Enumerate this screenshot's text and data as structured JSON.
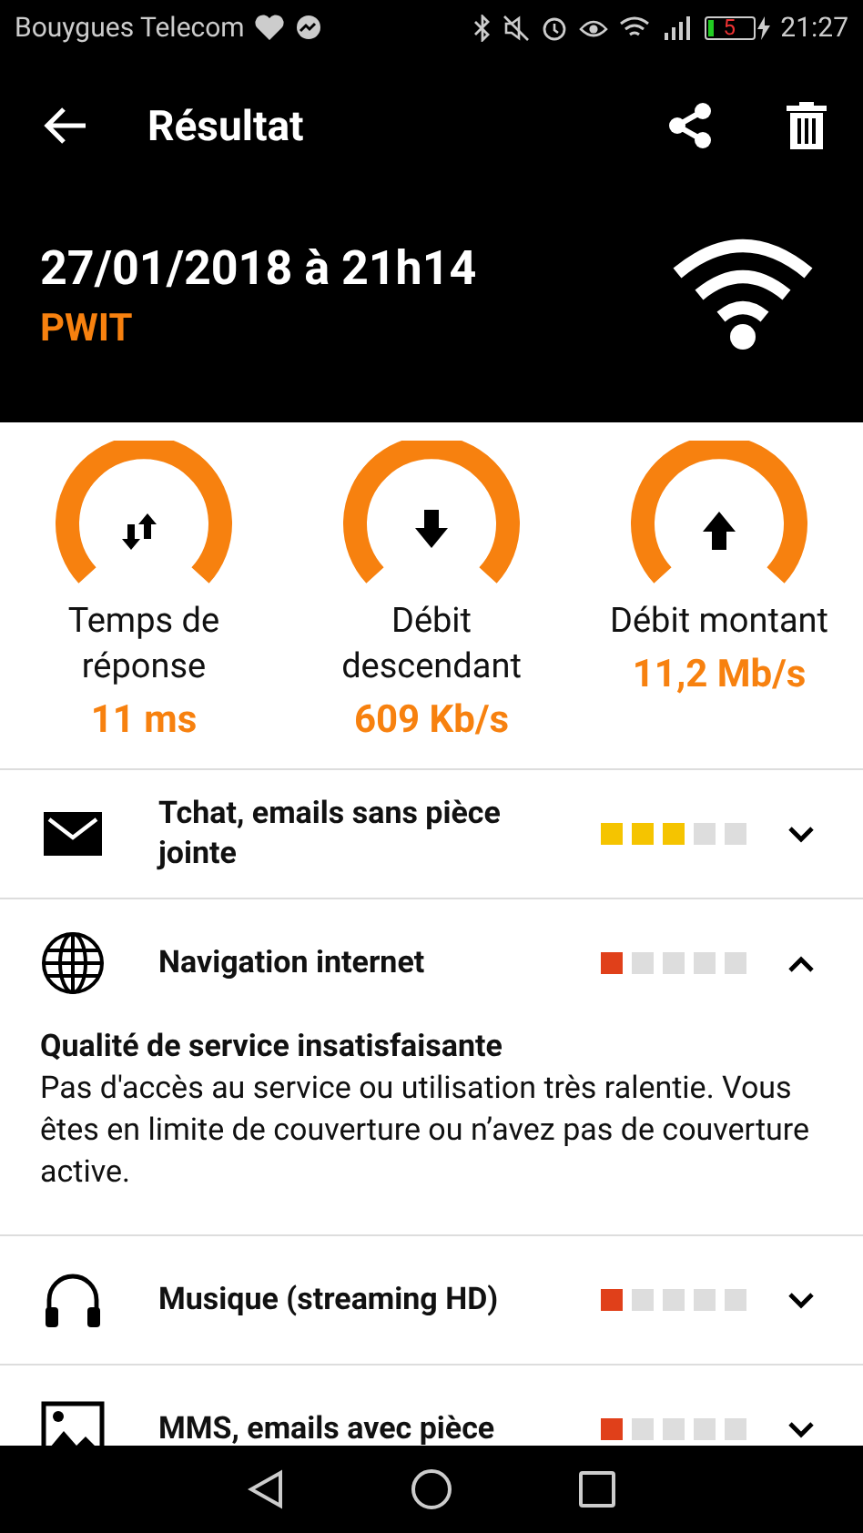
{
  "status_bar": {
    "carrier": "Bouygues Telecom",
    "battery": "5",
    "time": "21:27"
  },
  "toolbar": {
    "title": "Résultat"
  },
  "header": {
    "date": "27/01/2018 à 21h14",
    "network": "PWIT"
  },
  "gauges": [
    {
      "kind": "updown",
      "label": "Temps de réponse",
      "value": "11 ms"
    },
    {
      "kind": "down",
      "label": "Débit descendant",
      "value": "609 Kb/s"
    },
    {
      "kind": "up",
      "label": "Débit montant",
      "value": "11,2 Mb/s"
    }
  ],
  "usages": [
    {
      "kind": "envelope",
      "title": "Tchat, emails sans pièce jointe",
      "stars": 3,
      "color": "#f5c400",
      "expanded": false
    },
    {
      "kind": "globe",
      "title": "Navigation internet",
      "stars": 1,
      "color": "#e0401a",
      "expanded": true,
      "detail_title": "Qualité de service insatisfaisante",
      "detail_text": "Pas d'accès au service ou utilisation très ralentie. Vous êtes en limite de couverture ou n’avez pas de couverture active."
    },
    {
      "kind": "headphones",
      "title": "Musique (streaming HD)",
      "stars": 1,
      "color": "#e0401a",
      "expanded": false
    },
    {
      "kind": "image",
      "title": "MMS, emails avec pièce",
      "stars": 1,
      "color": "#e0401a",
      "expanded": false
    }
  ]
}
